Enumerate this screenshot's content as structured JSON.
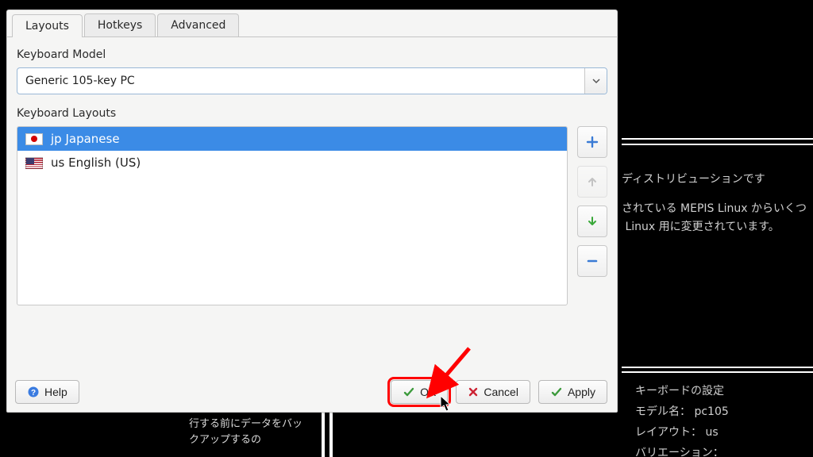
{
  "tabs": {
    "layouts": "Layouts",
    "hotkeys": "Hotkeys",
    "advanced": "Advanced"
  },
  "labels": {
    "keyboard_model": "Keyboard Model",
    "keyboard_layouts": "Keyboard Layouts"
  },
  "combo": {
    "value": "Generic 105-key PC"
  },
  "layout_items": [
    {
      "code": "jp",
      "label": "jp Japanese"
    },
    {
      "code": "us",
      "label": "us English (US)"
    }
  ],
  "buttons": {
    "help": "Help",
    "ok": "OK",
    "cancel": "Cancel",
    "apply": "Apply"
  },
  "bg": {
    "line1": "ディストリビューションです",
    "line2": "されている MEPIS Linux からいくつ",
    "line3": " Linux 用に変更されています。",
    "kb_header": "キーボードの設定",
    "kb_model": "モデル名：   pc105",
    "kb_layout": "レイアウト：  us",
    "kb_variant": "バリエーション：",
    "frag": "行する前にデータをバックアップするの"
  }
}
